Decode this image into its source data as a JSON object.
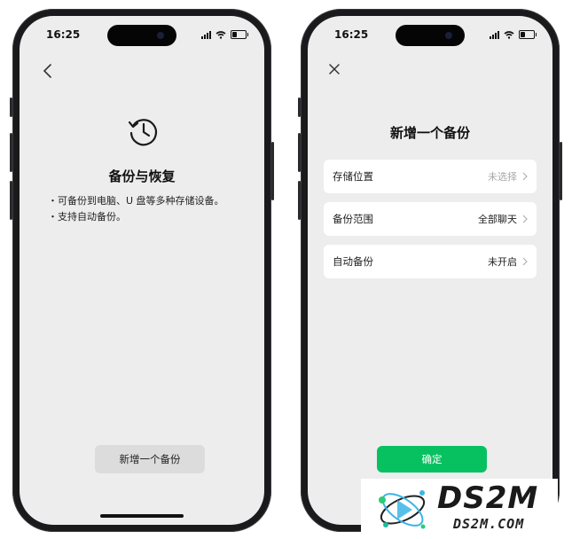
{
  "status_bar": {
    "time": "16:25"
  },
  "backup_restore": {
    "title": "备份与恢复",
    "bullets": [
      "・可备份到电脑、U 盘等多种存储设备。",
      "・支持自动备份。"
    ],
    "add_backup_label": "新增一个备份",
    "icons": {
      "back": "chevron-left-icon",
      "restore": "history-icon"
    }
  },
  "new_backup": {
    "title": "新增一个备份",
    "rows": [
      {
        "label": "存储位置",
        "value": "未选择"
      },
      {
        "label": "备份范围",
        "value": "全部聊天"
      },
      {
        "label": "自动备份",
        "value": "未开启"
      }
    ],
    "confirm_label": "确定",
    "icons": {
      "close": "close-icon"
    }
  },
  "watermark": {
    "big": "DS2M",
    "small": "DS2M.COM"
  },
  "colors": {
    "accent": "#07c160",
    "screen_bg": "#ededed"
  }
}
